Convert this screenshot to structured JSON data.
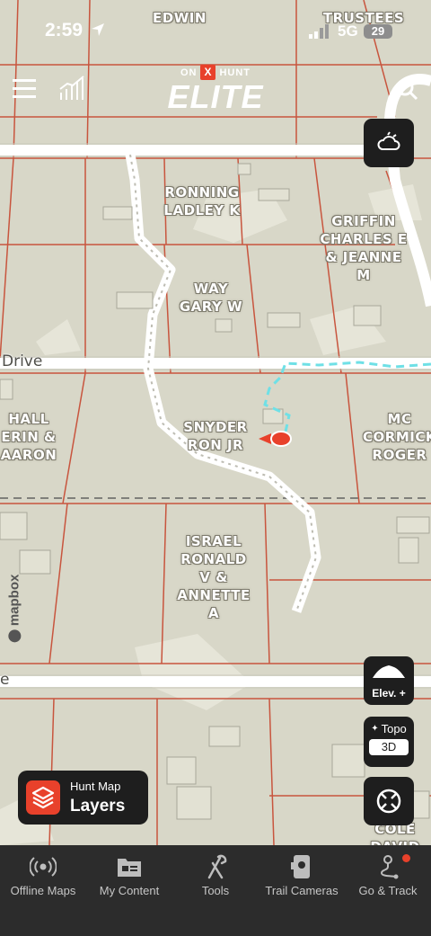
{
  "status_bar": {
    "time": "2:59",
    "network": "5G",
    "battery": "29"
  },
  "header": {
    "brand_top_left": "ON",
    "brand_x": "X",
    "brand_top_right": "HUNT",
    "brand_main": "ELITE"
  },
  "map": {
    "roads": [
      "Drive",
      "e"
    ],
    "parcels": [
      {
        "label": "EDWIN"
      },
      {
        "label": "TRUSTEES"
      },
      {
        "label": "RONNING\nLADLEY K"
      },
      {
        "label": "GRIFFIN\nCHARLES E\n& JEANNE\nM"
      },
      {
        "label": "WAY\nGARY W"
      },
      {
        "label": "HALL\nERIN &\nAARON"
      },
      {
        "label": "SNYDER\nRON JR"
      },
      {
        "label": "MC\nCORMICK\nROGER"
      },
      {
        "label": "ISRAEL\nRONALD\nV &\nANNETTE\nA"
      },
      {
        "label": "COLE\nDAVID"
      }
    ],
    "attribution": "mapbox"
  },
  "controls": {
    "elevation_label": "Elev. +",
    "topo_label": "Topo",
    "three_d_label": "3D"
  },
  "layers_button": {
    "subtitle": "Hunt Map",
    "title": "Layers"
  },
  "bottom_nav": [
    {
      "label": "Offline Maps",
      "icon": "offline-maps-icon"
    },
    {
      "label": "My Content",
      "icon": "my-content-icon"
    },
    {
      "label": "Tools",
      "icon": "tools-icon"
    },
    {
      "label": "Trail Cameras",
      "icon": "trail-camera-icon"
    },
    {
      "label": "Go & Track",
      "icon": "go-track-icon"
    }
  ],
  "colors": {
    "map_bg": "#d8d7c8",
    "parcel_line": "#c8553e",
    "accent": "#e8412b",
    "track": "#6fe0e6",
    "button_bg": "#1e1e1e",
    "nav_bg": "#2c2c2c"
  }
}
